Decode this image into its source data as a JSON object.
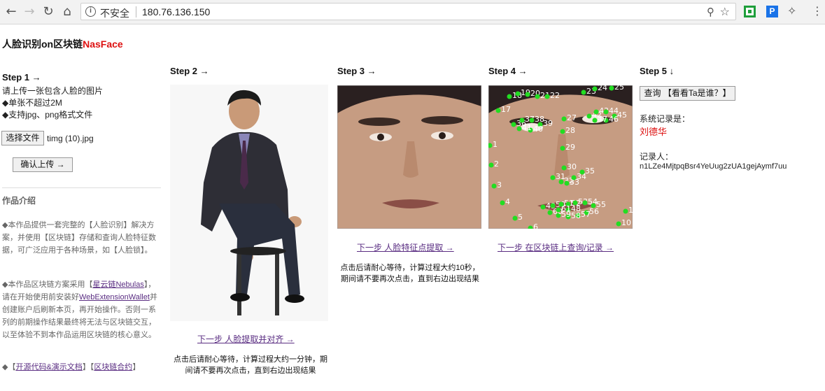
{
  "browser": {
    "insecure_label": "不安全",
    "url": "180.76.136.150"
  },
  "site": {
    "title_prefix": "人脸识别on区块链",
    "brand": "NasFace"
  },
  "step1": {
    "heading": "Step 1 →",
    "desc": "请上传一张包含人脸的图片",
    "rule1": "◆单张不超过2M",
    "rule2": "◆支持jpg、png格式文件",
    "choose_file_label": "选择文件",
    "file_name": "timg (10).jpg",
    "upload_label": "确认上传 →"
  },
  "intro": {
    "heading": "作品介绍",
    "para1": "◆本作品提供一套完整的【人脸识别】解决方案，并使用【区块链】存储和查询人脸特征数据，可广泛应用于各种场景，如【人脸锁】。",
    "para2_a": "◆本作品区块链方案采用【",
    "para2_link1": "星云链Nebulas",
    "para2_b": "】，请在开始使用前安装好",
    "para2_link2": "WebExtensionWallet",
    "para2_c": "并创建账户后刷新本页，再开始操作。否则一系列的前期操作结果最终将无法与区块链交互，以至体验不到本作品运用区块链的核心意义。",
    "para3_a": "◆【",
    "para3_link1": "开源代码&演示文档",
    "para3_b": "】【",
    "para3_link2": "区块链合约",
    "para3_c": "】"
  },
  "step2": {
    "heading": "Step 2 →",
    "next_link": "下一步 人脸提取并对齐 →",
    "note": "点击后请耐心等待，计算过程大约一分钟，期间请不要再次点击，直到右边出现结果"
  },
  "step3": {
    "heading": "Step 3 →",
    "next_link": "下一步 人脸特征点提取 →",
    "note": "点击后请耐心等待，计算过程大约10秒，期间请不要再次点击，直到右边出现结果"
  },
  "step4": {
    "heading": "Step 4 →",
    "next_link": "下一步 在区块链上查询/记录 →",
    "landmark_labels": [
      "18",
      "19",
      "20",
      "21",
      "22",
      "23",
      "24",
      "25",
      "17",
      "27",
      "28",
      "29",
      "30",
      "31",
      "32",
      "33",
      "34",
      "35",
      "36",
      "37",
      "38",
      "39",
      "40",
      "41",
      "42",
      "43",
      "44",
      "45",
      "46",
      "47",
      "48",
      "1",
      "2",
      "3",
      "4",
      "5",
      "6",
      "10",
      "16",
      "49",
      "50",
      "51",
      "52",
      "53",
      "54",
      "55",
      "56",
      "57",
      "58",
      "59",
      "60",
      "61"
    ]
  },
  "step5": {
    "heading": "Step 5 ↓",
    "query_label": "查询 【看看Ta是谁？】",
    "result_label": "系统记录是：",
    "result_name": "刘德华",
    "recorder_label": "记录人：",
    "recorder_id": "n1LZe4MjtpqBsr4YeUug2zUA1gejAymf7uu"
  },
  "colors": {
    "brand": "#dd1111",
    "link": "#5a2d82",
    "landmark": "#22dd22"
  }
}
